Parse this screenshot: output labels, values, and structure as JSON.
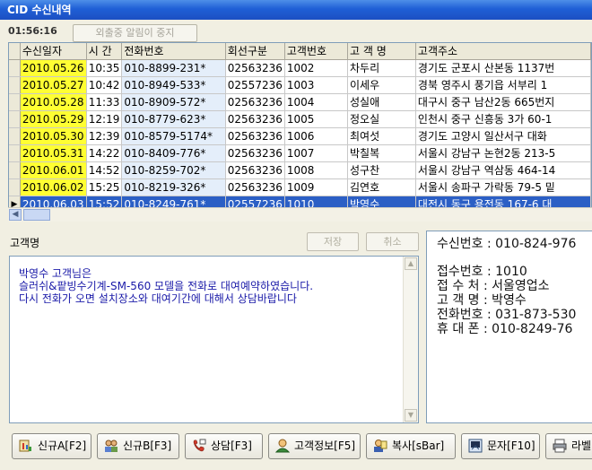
{
  "window": {
    "title": "CID 수신내역"
  },
  "toolbar": {
    "clock": "01:56:16",
    "away_label": "외출중 알림이 중지"
  },
  "grid": {
    "columns": [
      "수신일자",
      "시 간",
      "전화번호",
      "회선구분",
      "고객번호",
      "고 객 명",
      "고객주소"
    ],
    "rows": [
      {
        "date": "2010.05.26",
        "time": "10:35",
        "phone": "010-8899-231*",
        "line": "02563236",
        "cust_no": "1002",
        "name": "차두리",
        "addr": "경기도 군포시 산본동 1137번"
      },
      {
        "date": "2010.05.27",
        "time": "10:42",
        "phone": "010-8949-533*",
        "line": "02557236",
        "cust_no": "1003",
        "name": "이세우",
        "addr": "경북 영주시 풍기읍 서부리 1"
      },
      {
        "date": "2010.05.28",
        "time": "11:33",
        "phone": "010-8909-572*",
        "line": "02563236",
        "cust_no": "1004",
        "name": "성실애",
        "addr": "대구시 중구 남산2동 665번지"
      },
      {
        "date": "2010.05.29",
        "time": "12:19",
        "phone": "010-8779-623*",
        "line": "02563236",
        "cust_no": "1005",
        "name": "정오실",
        "addr": "인천시 중구 신흥동 3가 60-1"
      },
      {
        "date": "2010.05.30",
        "time": "12:39",
        "phone": "010-8579-5174*",
        "line": "02563236",
        "cust_no": "1006",
        "name": "최여섯",
        "addr": "경기도 고양시 일산서구 대화"
      },
      {
        "date": "2010.05.31",
        "time": "14:22",
        "phone": "010-8409-776*",
        "line": "02563236",
        "cust_no": "1007",
        "name": "박칠복",
        "addr": "서울시 강남구 논현2동 213-5"
      },
      {
        "date": "2010.06.01",
        "time": "14:52",
        "phone": "010-8259-702*",
        "line": "02563236",
        "cust_no": "1008",
        "name": "성구찬",
        "addr": "서울시 강남구 역삼동 464-14"
      },
      {
        "date": "2010.06.02",
        "time": "15:25",
        "phone": "010-8219-326*",
        "line": "02563236",
        "cust_no": "1009",
        "name": "김연호",
        "addr": "서울시 송파구 가락동 79-5 밑"
      },
      {
        "date": "2010.06.03",
        "time": "15:52",
        "phone": "010-8249-761*",
        "line": "02557236",
        "cust_no": "1010",
        "name": "박영수",
        "addr": "대전시 동구 용전동 167-6 대"
      }
    ],
    "selected_index": 8
  },
  "detail": {
    "customer_label": "고객명",
    "save_label": "저장",
    "cancel_label": "취소",
    "memo": "박영수 고객님은\n슬러쉬&팥빙수기계-SM-560 모델을 전화로 대여예약하였습니다.\n다시 전화가 오면 설치장소와 대여기간에 대해서 상담바랍니다"
  },
  "info": {
    "lines": [
      "수신번호 : 010-824-976",
      "접수번호 : 1010",
      "접 수 처 : 서울영업소",
      "고 객 명 : 박영수",
      "전화번호 : 031-873-530",
      "휴 대 폰 : 010-8249-76"
    ]
  },
  "buttons": [
    {
      "label": "신규A[F2]",
      "icon": "new-a-icon"
    },
    {
      "label": "신규B[F3]",
      "icon": "new-b-icon"
    },
    {
      "label": "상담[F3]",
      "icon": "consult-icon"
    },
    {
      "label": "고객정보[F5]",
      "icon": "customer-info-icon"
    },
    {
      "label": "복사[sBar]",
      "icon": "copy-icon"
    },
    {
      "label": "문자[F10]",
      "icon": "sms-icon"
    },
    {
      "label": "라벨",
      "icon": "label-print-icon"
    }
  ],
  "colors": {
    "title_bar": "#1f5fd6",
    "date_highlight": "#ffff33",
    "selected_row": "#2b5fc5",
    "memo_text": "#1a1aa8"
  }
}
